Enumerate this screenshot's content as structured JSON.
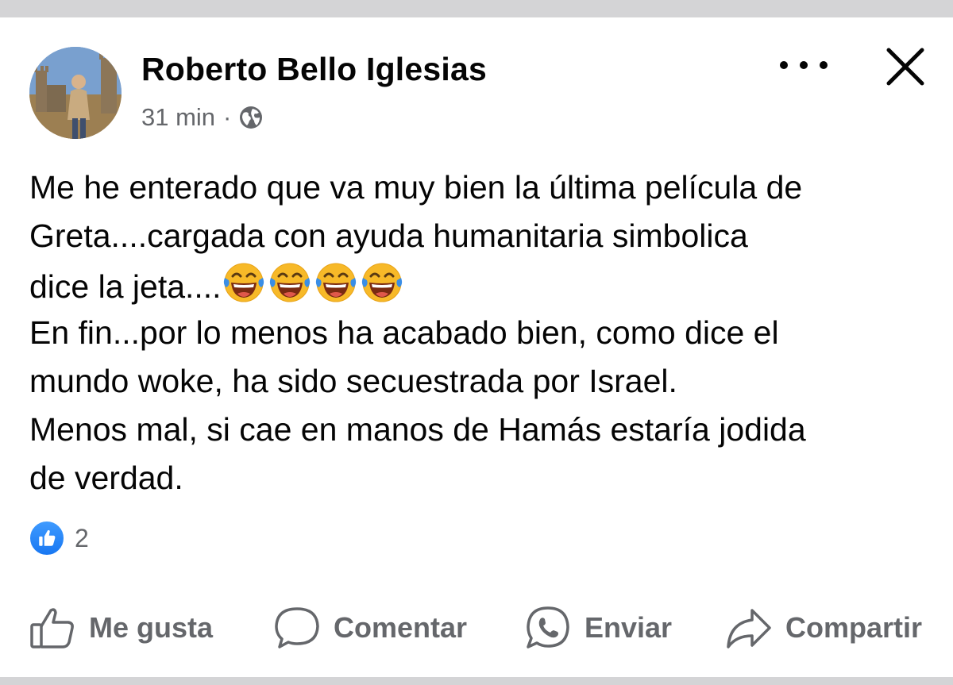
{
  "post": {
    "author": "Roberto Bello Iglesias",
    "timestamp": "31 min",
    "separator": "·",
    "privacy_icon": "globe-icon",
    "text_lines": [
      "Me he enterado que va muy bien la última película de",
      "Greta....cargada con ayuda humanitaria simbolica",
      "dice la jeta....",
      "En fin...por lo menos ha acabado bien, como dice el",
      "mundo woke, ha sido secuestrada por Israel.",
      "Menos mal, si cae en manos de Hamás estaría jodida",
      "de verdad."
    ],
    "emojis": [
      "😂",
      "😂",
      "😂",
      "😂"
    ],
    "reaction_icon": "like-icon",
    "reaction_count": "2"
  },
  "actions": {
    "like_label": "Me gusta",
    "comment_label": "Comentar",
    "send_label": "Enviar",
    "share_label": "Compartir"
  },
  "colors": {
    "primary_text": "#050505",
    "secondary_text": "#65676b",
    "like_blue": "#1877f2",
    "divider_gray": "#d4d4d6"
  }
}
